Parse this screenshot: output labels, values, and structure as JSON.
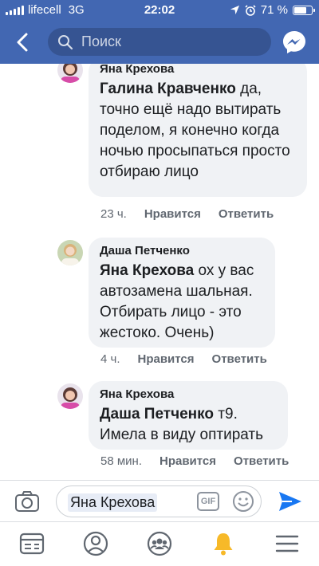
{
  "status_bar": {
    "carrier": "lifecell",
    "network": "3G",
    "time": "22:02",
    "battery": "71 %",
    "battery_level": 0.71
  },
  "header": {
    "search_placeholder": "Поиск",
    "icons": [
      "back-arrow-icon",
      "search-icon",
      "messenger-icon"
    ]
  },
  "comments": [
    {
      "author": "Яна Крехова",
      "mention": "Галина Кравченко",
      "text": " да, точно ещё надо вытирать поделом, я конечно когда ночью просыпаться просто отбираю лицо",
      "time": "23 ч.",
      "like_label": "Нравится",
      "reply_label": "Ответить"
    },
    {
      "author": "Даша Петченко",
      "mention": "Яна Крехова",
      "text": " ох у вас автозамена шальная. Отбирать лицо - это жестоко. Очень)",
      "time": "4 ч.",
      "like_label": "Нравится",
      "reply_label": "Ответить"
    },
    {
      "author": "Яна Крехова",
      "mention": "Даша Петченко",
      "text": " т9. Имела в виду оптирать",
      "time": "58 мин.",
      "like_label": "Нравится",
      "reply_label": "Ответить"
    }
  ],
  "composer": {
    "mention_value": "Яна Крехова",
    "gif_label": "GIF",
    "icons": [
      "camera-icon",
      "emoji-icon",
      "send-icon"
    ]
  },
  "bottom_nav": {
    "items": [
      "news-feed-icon",
      "profile-icon",
      "groups-icon",
      "notifications-bell-icon",
      "menu-icon"
    ],
    "active": "notifications-bell-icon"
  },
  "colors": {
    "brand": "#4267b2",
    "bubble": "#f0f2f5",
    "secondary_text": "#606770",
    "bell": "#f7b928",
    "send": "#1877f2"
  }
}
